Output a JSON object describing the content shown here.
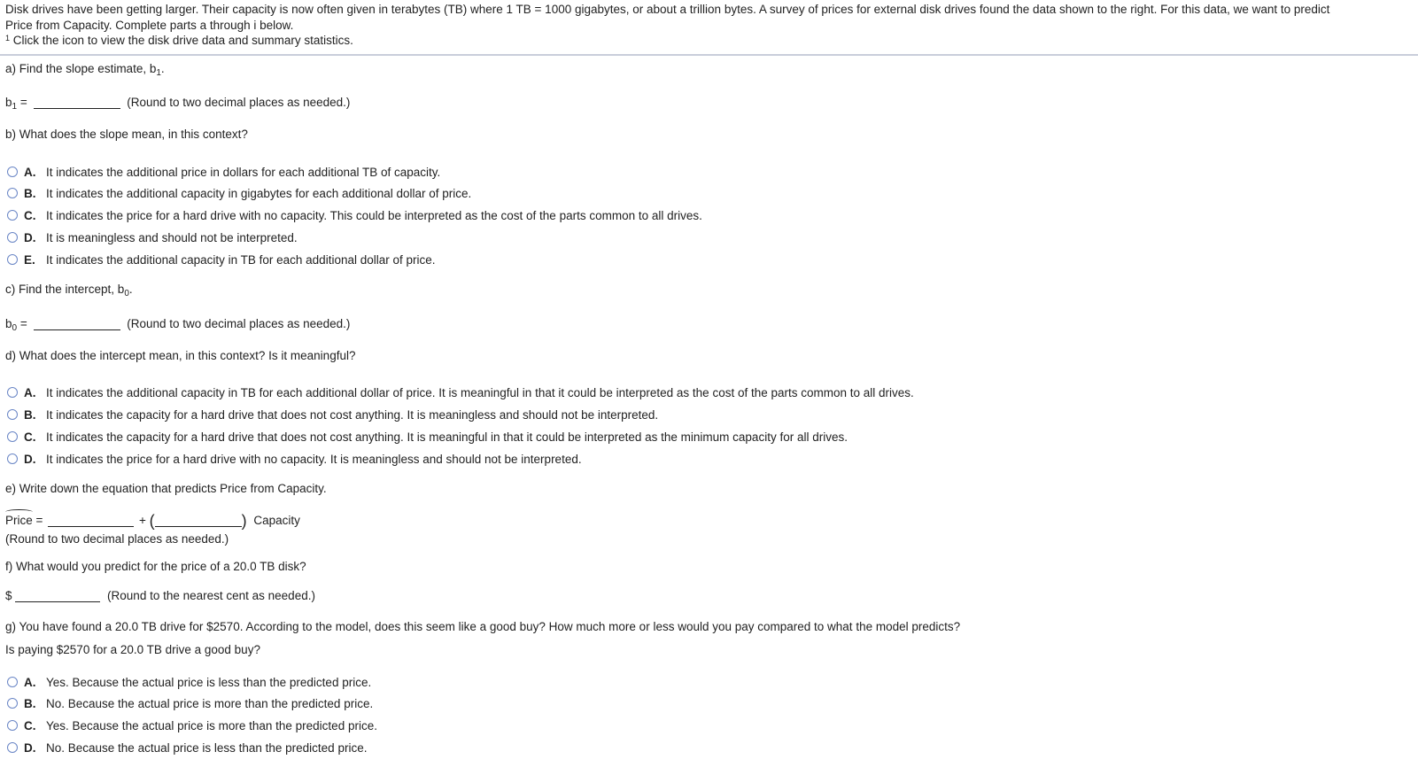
{
  "intro": {
    "line1": "Disk drives have been getting larger. Their capacity is now often given in terabytes (TB) where 1 TB = 1000 gigabytes, or about a trillion bytes. A survey of prices for external disk drives found the data shown to the right. For this data, we want to predict",
    "line2": "Price from Capacity. Complete parts a through i below.",
    "footnote_mark": "1",
    "footnote_text": "Click the icon to view the disk drive data and summary statistics."
  },
  "part_a": {
    "prompt": "a) Find the slope estimate, b",
    "prompt_sub": "1",
    "prompt_end": ".",
    "label": "b",
    "label_sub": "1",
    "equals": "=",
    "value": "",
    "hint": "(Round to two decimal places as needed.)"
  },
  "part_b": {
    "prompt": "b) What does the slope mean, in this context?",
    "options": [
      {
        "letter": "A.",
        "text": "It indicates the additional price in dollars for each additional TB of capacity."
      },
      {
        "letter": "B.",
        "text": "It indicates the additional capacity in gigabytes for each additional dollar of price."
      },
      {
        "letter": "C.",
        "text": "It indicates the price for a hard drive with no capacity. This could be interpreted as the cost of the parts common to all drives."
      },
      {
        "letter": "D.",
        "text": "It is meaningless and should not be interpreted."
      },
      {
        "letter": "E.",
        "text": "It indicates the additional capacity in TB for each additional dollar of price."
      }
    ]
  },
  "part_c": {
    "prompt": "c) Find the intercept, b",
    "prompt_sub": "0",
    "prompt_end": ".",
    "label": "b",
    "label_sub": "0",
    "equals": "=",
    "value": "",
    "hint": "(Round to two decimal places as needed.)"
  },
  "part_d": {
    "prompt": "d) What does the intercept mean, in this context? Is it meaningful?",
    "options": [
      {
        "letter": "A.",
        "text": "It indicates the additional capacity in TB for each additional dollar of price. It is meaningful in that it could be interpreted as the cost of the parts common to all drives."
      },
      {
        "letter": "B.",
        "text": "It indicates the capacity for a hard drive that does not cost anything. It is meaningless and should not be interpreted."
      },
      {
        "letter": "C.",
        "text": "It indicates the capacity for a hard drive that does not cost anything. It is meaningful in that it could be interpreted as the minimum capacity for all drives."
      },
      {
        "letter": "D.",
        "text": "It indicates the price for a hard drive with no capacity. It is meaningless and should not be interpreted."
      }
    ]
  },
  "part_e": {
    "prompt": "e) Write down the equation that predicts Price from Capacity.",
    "lhs": "Price",
    "equals": "=",
    "plus": "+",
    "open_paren": "(",
    "close_paren": ")",
    "rhs_var": "Capacity",
    "intercept_value": "",
    "slope_value": "",
    "hint": "(Round to two decimal places as needed.)"
  },
  "part_f": {
    "prompt": "f) What would you predict for the price of a 20.0 TB disk?",
    "currency": "$",
    "value": "",
    "hint": "(Round to the nearest cent as needed.)"
  },
  "part_g": {
    "prompt": "g) You have found a 20.0 TB drive for $2570. According to the model, does this seem like a good buy? How much more or less would you pay compared to what the model predicts?",
    "subprompt": "Is paying $2570 for a 20.0 TB drive a good buy?",
    "options": [
      {
        "letter": "A.",
        "text": "Yes. Because the actual price is less than the predicted price."
      },
      {
        "letter": "B.",
        "text": "No. Because the actual price is more than the predicted price."
      },
      {
        "letter": "C.",
        "text": "Yes. Because the actual price is more than the predicted price."
      },
      {
        "letter": "D.",
        "text": "No. Because the actual price is less than the predicted price."
      }
    ]
  },
  "colors": {
    "radio_border": "#6a86c6",
    "divider": "#c9cdda",
    "text": "#222222"
  }
}
